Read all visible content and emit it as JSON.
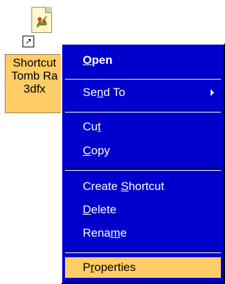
{
  "desktop_icon": {
    "label_lines": [
      "Shortcut",
      "Tomb Ra",
      "3dfx"
    ]
  },
  "context_menu": {
    "items": [
      {
        "pre": "",
        "key": "O",
        "post": "pen"
      },
      {
        "pre": "Se",
        "key": "n",
        "post": "d To"
      },
      {
        "pre": "Cu",
        "key": "t",
        "post": ""
      },
      {
        "pre": "",
        "key": "C",
        "post": "opy"
      },
      {
        "pre": "Create ",
        "key": "S",
        "post": "hortcut"
      },
      {
        "pre": "",
        "key": "D",
        "post": "elete"
      },
      {
        "pre": "Rena",
        "key": "m",
        "post": "e"
      },
      {
        "pre": "P",
        "key": "r",
        "post": "operties"
      }
    ]
  },
  "colors": {
    "menu_background": "#0000cc",
    "menu_text": "#ffffff",
    "highlight": "#ffcc66"
  }
}
